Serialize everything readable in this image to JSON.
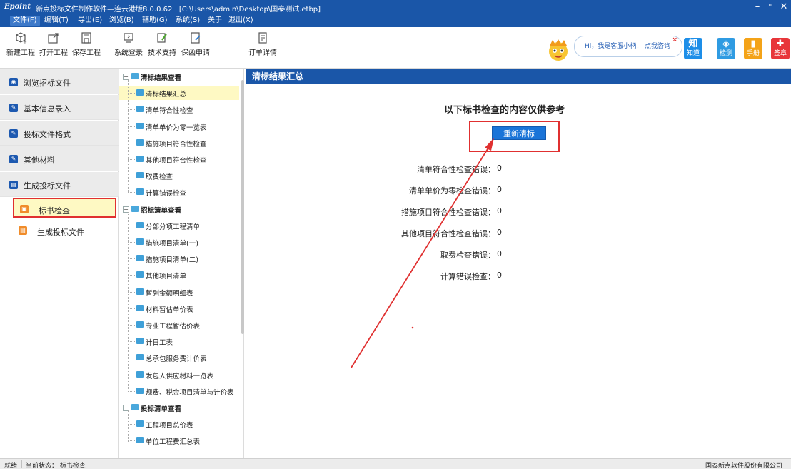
{
  "titlebar": {
    "logo": "Epoint",
    "title": "新点投标文件制作软件—连云港版8.0.0.62",
    "path": "[C:\\Users\\admin\\Desktop\\国泰测试.etbp]"
  },
  "menu": {
    "items": [
      "文件(F)",
      "编辑(T)",
      "导出(E)",
      "浏览(B)",
      "辅助(G)",
      "系统(S)",
      "关于",
      "退出(X)"
    ]
  },
  "toolbar": {
    "buttons": [
      "新建工程",
      "打开工程",
      "保存工程",
      "系统登录",
      "技术支持",
      "保函申请",
      "订单详情"
    ],
    "assistant_text": "Hi，我是客服小柄！  点我咨询",
    "right_buttons": [
      {
        "icon": "知",
        "label": "知道",
        "color": "#1d8ee8"
      },
      {
        "icon": "◈",
        "label": "检测",
        "color": "#2f9be2"
      },
      {
        "icon": "▮",
        "label": "手册",
        "color": "#f4a318"
      },
      {
        "icon": "✚",
        "label": "签章",
        "color": "#e8363a"
      }
    ]
  },
  "sidebar": {
    "items": [
      {
        "label": "浏览招标文件",
        "icon": "eye-icon"
      },
      {
        "label": "基本信息录入",
        "icon": "edit-icon"
      },
      {
        "label": "投标文件格式",
        "icon": "edit-icon"
      },
      {
        "label": "其他材料",
        "icon": "edit-icon"
      },
      {
        "label": "生成投标文件",
        "icon": "document-icon"
      }
    ],
    "sub_items": [
      {
        "label": "标书检查",
        "selected": true
      },
      {
        "label": "生成投标文件",
        "selected": false
      }
    ]
  },
  "tree": {
    "groups": [
      {
        "label": "清标结果查看",
        "children": [
          "清标结果汇总",
          "清单符合性检查",
          "清单单价为零一览表",
          "措施项目符合性检查",
          "其他项目符合性检查",
          "取费检查",
          "计算错误检查"
        ]
      },
      {
        "label": "招标清单查看",
        "children": [
          "分部分项工程清单",
          "措施项目清单(一)",
          "措施项目清单(二)",
          "其他项目清单",
          "暂列金额明细表",
          "材料暂估单价表",
          "专业工程暂估价表",
          "计日工表",
          "总承包服务费计价表",
          "发包人供应材料一览表",
          "规费、税金项目清单与计价表"
        ]
      },
      {
        "label": "投标清单查看",
        "children": [
          "工程项目总价表",
          "单位工程费汇总表"
        ]
      }
    ],
    "selected": "清标结果汇总"
  },
  "main": {
    "header": "清标结果汇总",
    "notice": "以下标书检查的内容仅供参考",
    "recheck_button": "重新清标",
    "results": [
      {
        "label": "清单符合性检查错误：",
        "value": "0"
      },
      {
        "label": "清单单价为零检查错误：",
        "value": "0"
      },
      {
        "label": "措施项目符合性检查错误：",
        "value": "0"
      },
      {
        "label": "其他项目符合性检查错误：",
        "value": "0"
      },
      {
        "label": "取费检查错误：",
        "value": "0"
      },
      {
        "label": "计算错误检查：",
        "value": "0"
      }
    ]
  },
  "statusbar": {
    "ready": "就绪",
    "state": "当前状态：  标书检查",
    "company": "国泰新点软件股份有限公司"
  },
  "colors": {
    "brand_blue": "#1a56a8",
    "highlight_red": "#e03030",
    "selected_bg": "#fef9c3"
  }
}
